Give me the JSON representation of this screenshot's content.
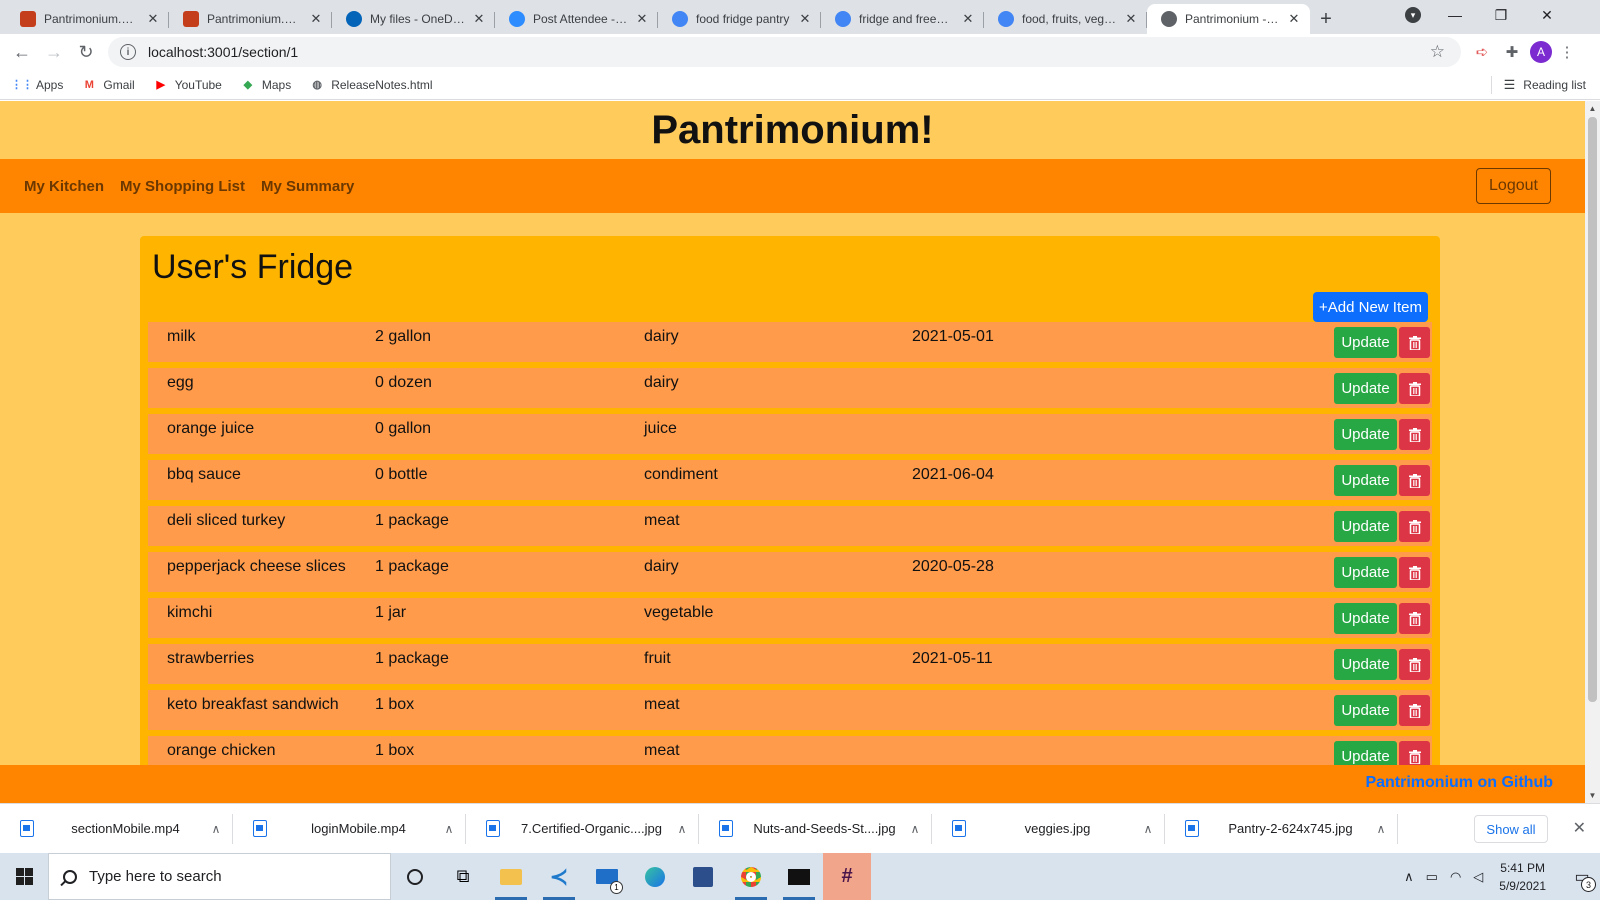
{
  "browser": {
    "tabs": [
      {
        "title": "Pantrimonium.pptx",
        "icon": "powerpoint-icon",
        "color": "#c43e1c"
      },
      {
        "title": "Pantrimonium.pptx",
        "icon": "powerpoint-icon",
        "color": "#c43e1c"
      },
      {
        "title": "My files - OneDrive",
        "icon": "onedrive-icon",
        "color": "#0364b8"
      },
      {
        "title": "Post Attendee - Zo",
        "icon": "zoom-icon",
        "color": "#2d8cff"
      },
      {
        "title": "food fridge pantry",
        "icon": "google-icon",
        "color": "#4285f4"
      },
      {
        "title": "fridge and freezer s",
        "icon": "google-icon",
        "color": "#4285f4"
      },
      {
        "title": "food, fruits, veggie",
        "icon": "google-icon",
        "color": "#4285f4"
      },
      {
        "title": "Pantrimonium - Ho",
        "icon": "globe-icon",
        "color": "#5f6368"
      }
    ],
    "url": "localhost:3001/section/1",
    "profile_initial": "A",
    "bookmarks": [
      {
        "label": "Apps",
        "icon": "apps-grid-icon"
      },
      {
        "label": "Gmail",
        "icon": "gmail-icon"
      },
      {
        "label": "YouTube",
        "icon": "youtube-icon"
      },
      {
        "label": "Maps",
        "icon": "maps-icon"
      },
      {
        "label": "ReleaseNotes.html",
        "icon": "globe-icon"
      }
    ],
    "reading_list": "Reading list"
  },
  "app": {
    "title": "Pantrimonium!",
    "nav": [
      "My Kitchen",
      "My Shopping List",
      "My Summary"
    ],
    "logout": "Logout",
    "section_title": "User's Fridge",
    "add_button": "+Add New Item",
    "update_label": "Update",
    "items": [
      {
        "name": "milk",
        "qty": "2 gallon",
        "category": "dairy",
        "date": "2021-05-01"
      },
      {
        "name": "egg",
        "qty": "0 dozen",
        "category": "dairy",
        "date": ""
      },
      {
        "name": "orange juice",
        "qty": "0 gallon",
        "category": "juice",
        "date": ""
      },
      {
        "name": "bbq sauce",
        "qty": "0 bottle",
        "category": "condiment",
        "date": "2021-06-04"
      },
      {
        "name": "deli sliced turkey",
        "qty": "1 package",
        "category": "meat",
        "date": ""
      },
      {
        "name": "pepperjack cheese slices",
        "qty": "1 package",
        "category": "dairy",
        "date": "2020-05-28"
      },
      {
        "name": "kimchi",
        "qty": "1 jar",
        "category": "vegetable",
        "date": ""
      },
      {
        "name": "strawberries",
        "qty": "1 package",
        "category": "fruit",
        "date": "2021-05-11"
      },
      {
        "name": "keto breakfast sandwich",
        "qty": "1 box",
        "category": "meat",
        "date": ""
      },
      {
        "name": "orange chicken",
        "qty": "1 box",
        "category": "meat",
        "date": ""
      }
    ],
    "footer_link": "Pantrimonium on Github"
  },
  "downloads": {
    "files": [
      "sectionMobile.mp4",
      "loginMobile.mp4",
      "7.Certified-Organic....jpg",
      "Nuts-and-Seeds-St....jpg",
      "veggies.jpg",
      "Pantry-2-624x745.jpg"
    ],
    "show_all": "Show all"
  },
  "taskbar": {
    "search_placeholder": "Type here to search",
    "time": "5:41 PM",
    "date": "5/9/2021",
    "notification_count": "3",
    "mail_badge": "1"
  },
  "colors": {
    "page_bg": "#ffcc5c",
    "nav_bg": "#ff8400",
    "card_bg": "#ffb400",
    "row_bg": "#ff9b4a",
    "add_button": "#0d6efd",
    "update_button": "#28a745",
    "delete_button": "#dc3545"
  }
}
